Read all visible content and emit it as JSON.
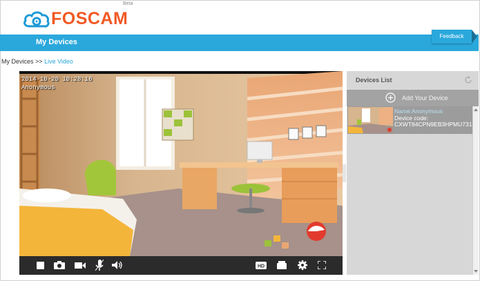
{
  "header": {
    "logo_text": "FOSCAM",
    "logo_badge": "Beta",
    "feedback_label": "Feedback"
  },
  "nav": {
    "items": [
      {
        "label": "My Devices"
      }
    ]
  },
  "breadcrumb": {
    "root": "My Devices",
    "separator": ">>",
    "current": "Live Video"
  },
  "video": {
    "timestamp": "2014-10-20 10:28:16",
    "camera_name": "Anonymous",
    "toolbar_left": [
      "stop-icon",
      "snapshot-camera-icon",
      "record-video-icon",
      "microphone-icon",
      "speaker-icon"
    ],
    "toolbar_right": [
      "hd-quality-icon",
      "storage-icon",
      "settings-gear-icon",
      "fullscreen-icon"
    ],
    "hd_label": "HD"
  },
  "devices_panel": {
    "title": "Devices List",
    "add_label": "Add Your Device",
    "devices": [
      {
        "name": "Name:Anonymous",
        "code_label": "Device code:",
        "code": "CXWT84CPN9EB3HPMU731"
      }
    ]
  },
  "colors": {
    "brand_orange": "#f15a24",
    "nav_blue": "#2aa8dc",
    "toolbar_dark": "#2b2b2b",
    "panel_gray": "#d7d7d7"
  }
}
